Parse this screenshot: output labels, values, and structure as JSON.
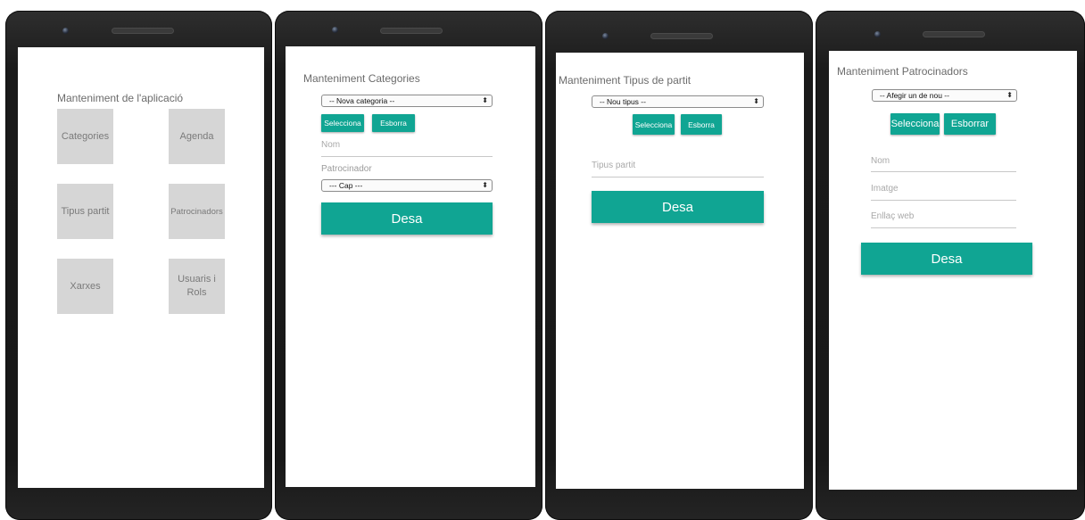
{
  "colors": {
    "accent": "#10a593",
    "tile": "#d6d6d6",
    "device": "#1a1a1a"
  },
  "screens": {
    "maintenance": {
      "title": "Manteniment de l'aplicació",
      "tiles": [
        "Categories",
        "Agenda",
        "Tipus partit",
        "Patrocinadors",
        "Xarxes",
        "Usuaris i Rols"
      ]
    },
    "categories": {
      "title": "Manteniment Categories",
      "select_value": "-- Nova categoria --",
      "select_label": "Selecciona",
      "delete_label": "Esborra",
      "name_placeholder": "Nom",
      "sponsor_label": "Patrocinador",
      "sponsor_value": "--- Cap ---",
      "save_label": "Desa"
    },
    "match_types": {
      "title": "Manteniment Tipus de partit",
      "select_value": "-- Nou tipus --",
      "select_label": "Selecciona",
      "delete_label": "Esborra",
      "type_placeholder": "Tipus partit",
      "save_label": "Desa"
    },
    "sponsors": {
      "title": "Manteniment Patrocinadors",
      "select_value": "-- Afegir un de nou --",
      "select_label": "Selecciona",
      "delete_label": "Esborrar",
      "name_placeholder": "Nom",
      "image_placeholder": "Imatge",
      "link_placeholder": "Enllaç web",
      "save_label": "Desa"
    }
  }
}
